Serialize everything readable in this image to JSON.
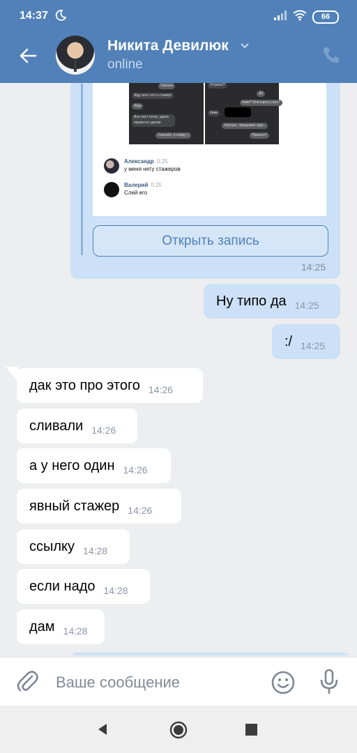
{
  "status_bar": {
    "time": "14:37",
    "battery": "66"
  },
  "header": {
    "contact_name": "Никита Девилюк",
    "contact_status": "online"
  },
  "shared_post": {
    "screenshot_left": [
      "Хорошо",
      "Жду пост что я стажёр!",
      "Жди",
      "Все пост готов, удачи провести сделки",
      "Спасибо, я пойду :)"
    ],
    "screenshot_right": [
      "Устроил?",
      "Да",
      "Киви? Или карта у вас?",
      "Киви",
      "Хорошо, ожидываю жди...",
      "Пришло?"
    ],
    "comments": [
      {
        "author": "Александр",
        "time": "0:25",
        "text": "у меня нету стажеров"
      },
      {
        "author": "Валерий",
        "time": "0:25",
        "text": "Слей его"
      }
    ],
    "open_button_label": "Открыть запись",
    "time": "14:25"
  },
  "messages": [
    {
      "direction": "out",
      "text": "Ну типо да",
      "time": "14:25"
    },
    {
      "direction": "out",
      "text": ":/",
      "time": "14:25"
    },
    {
      "direction": "in",
      "text": "дак это про этого",
      "time": "14:26"
    },
    {
      "direction": "in",
      "text": "сливали",
      "time": "14:26"
    },
    {
      "direction": "in",
      "text": "а у него один",
      "time": "14:26"
    },
    {
      "direction": "in",
      "text": "явный стажер",
      "time": "14:26"
    },
    {
      "direction": "in",
      "text": "ссылку",
      "time": "14:28"
    },
    {
      "direction": "in",
      "text": "если надо",
      "time": "14:28"
    },
    {
      "direction": "in",
      "text": "дам",
      "time": "14:28"
    }
  ],
  "composer": {
    "placeholder": "Ваше сообщение"
  },
  "colors": {
    "header": "#5181b8",
    "outgoing_bubble": "#cce1f7",
    "incoming_bubble": "#ffffff",
    "background": "#edeef0"
  }
}
